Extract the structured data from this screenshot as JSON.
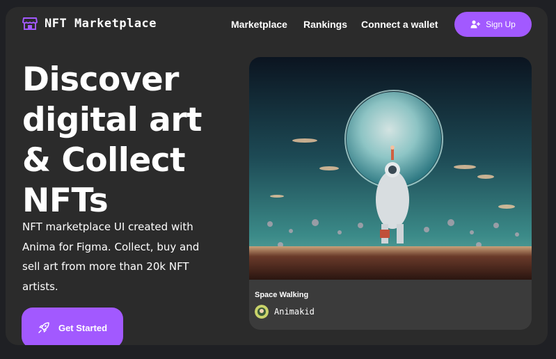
{
  "brand": {
    "name": "NFT Marketplace",
    "icon": "storefront-icon"
  },
  "nav": {
    "links": [
      "Marketplace",
      "Rankings",
      "Connect a wallet"
    ],
    "signup_label": "Sign Up",
    "signup_icon": "user-plus-icon"
  },
  "hero": {
    "headline_lines": [
      "Discover",
      "digital art",
      "& Collect",
      "NFTs"
    ],
    "subtitle_lines": [
      "NFT marketplace UI created with",
      "Anima for Figma. Collect, buy and",
      "sell art from more than 20k NFT",
      "artists."
    ],
    "cta_label": "Get Started",
    "cta_icon": "rocket-icon"
  },
  "featured": {
    "title": "Space Walking",
    "artist": "Animakid",
    "avatar_icon": "artist-avatar"
  },
  "colors": {
    "accent": "#a259ff",
    "background": "#2b2b2b",
    "card": "#3b3b3b",
    "page": "#1f2024"
  }
}
